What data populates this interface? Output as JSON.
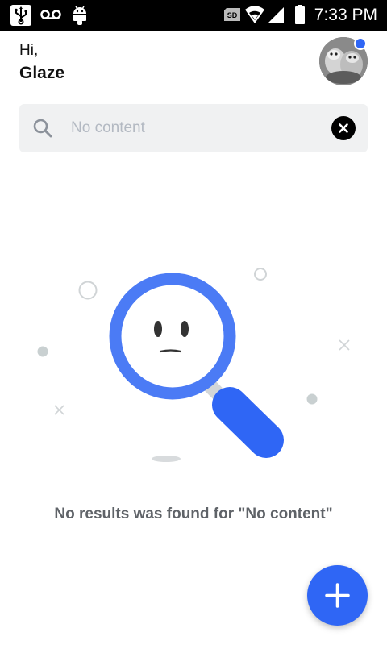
{
  "status_bar": {
    "time": "7:33 PM",
    "left_icons": [
      "usb-icon",
      "voicemail-icon",
      "android-icon"
    ],
    "right_icons": [
      "sd-card-icon",
      "wifi-icon",
      "signal-icon",
      "battery-icon"
    ],
    "sd_label": "SD"
  },
  "header": {
    "greeting": "Hi,",
    "username": "Glaze",
    "avatar_icon": "avatar",
    "notification_dot_color": "#2f66f5"
  },
  "search": {
    "placeholder": "No content",
    "value": "No content",
    "search_icon": "search-icon",
    "clear_icon": "close-icon"
  },
  "empty_state": {
    "illustration": "magnifier-sad-face-icon",
    "message": "No results was found for \"No content\""
  },
  "fab": {
    "icon": "plus-icon",
    "color": "#2f66f5"
  },
  "colors": {
    "accent": "#2f66f5",
    "muted_text": "#5f6368",
    "search_bg": "#f0f1f2"
  }
}
